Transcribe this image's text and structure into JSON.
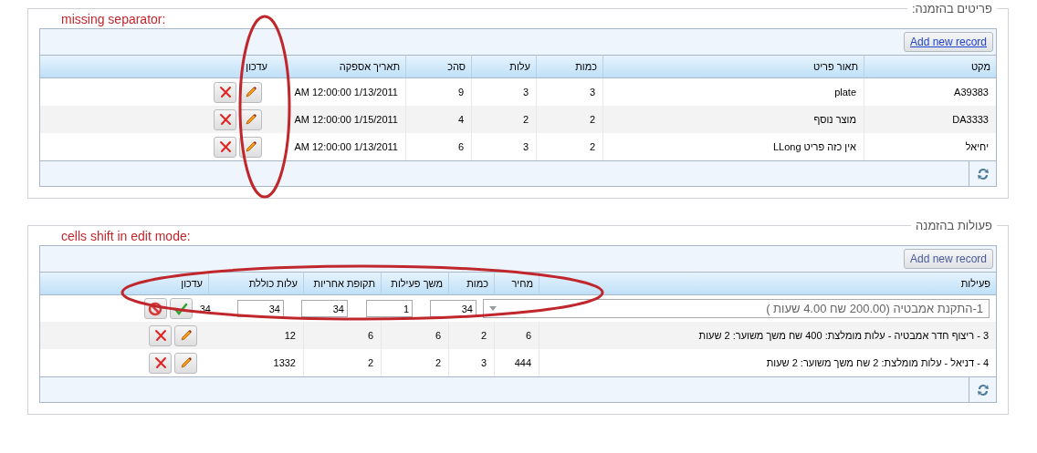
{
  "sections": [
    {
      "legend": "פריטים בהזמנה:",
      "annotation": "missing separator:",
      "add_button": {
        "label": "Add new record",
        "focused": true
      },
      "columns": [
        "מקט",
        "תאור פריט",
        "כמות",
        "עלות",
        "סהכ",
        "תאריך אספקה",
        "עדכון"
      ],
      "rows": [
        {
          "kind": "view",
          "cells": [
            "A39383",
            "plate",
            "3",
            "3",
            "9",
            "AM 12:00:00 1/13/2011"
          ]
        },
        {
          "kind": "view",
          "cells": [
            "DA3333",
            "מוצר נוסף",
            "2",
            "2",
            "4",
            "AM 12:00:00 1/15/2011"
          ]
        },
        {
          "kind": "view",
          "cells": [
            "יחיאל",
            "אין כזה פריט LLong",
            "2",
            "3",
            "6",
            "AM 12:00:00 1/13/2011"
          ]
        }
      ]
    },
    {
      "legend": "פעולות בהזמנה",
      "annotation": "cells shift in edit mode:",
      "add_button": {
        "label": "Add new record",
        "focused": false
      },
      "columns": [
        "פעילות",
        "מחיר",
        "כמות",
        "משך פעילות",
        "תקופת אחריות",
        "עלות כוללת",
        "עדכון"
      ],
      "rows": [
        {
          "kind": "edit",
          "select": "1-התקנת אמבטיה (200.00 שח 4.00 שעות )",
          "inputs": [
            "34",
            "1",
            "34",
            "34"
          ],
          "total": "34"
        },
        {
          "kind": "view",
          "cells": [
            "3 - ריצוף חדר אמבטיה - עלות מומלצת: 400 שח משך משוער: 2 שעות",
            "6",
            "2",
            "6",
            "6",
            "12"
          ]
        },
        {
          "kind": "view",
          "cells": [
            "4 - דניאל - עלות מומלצת: 2 שח משך משוער: 2 שעות",
            "444",
            "3",
            "2",
            "2",
            "1332"
          ]
        }
      ]
    }
  ]
}
